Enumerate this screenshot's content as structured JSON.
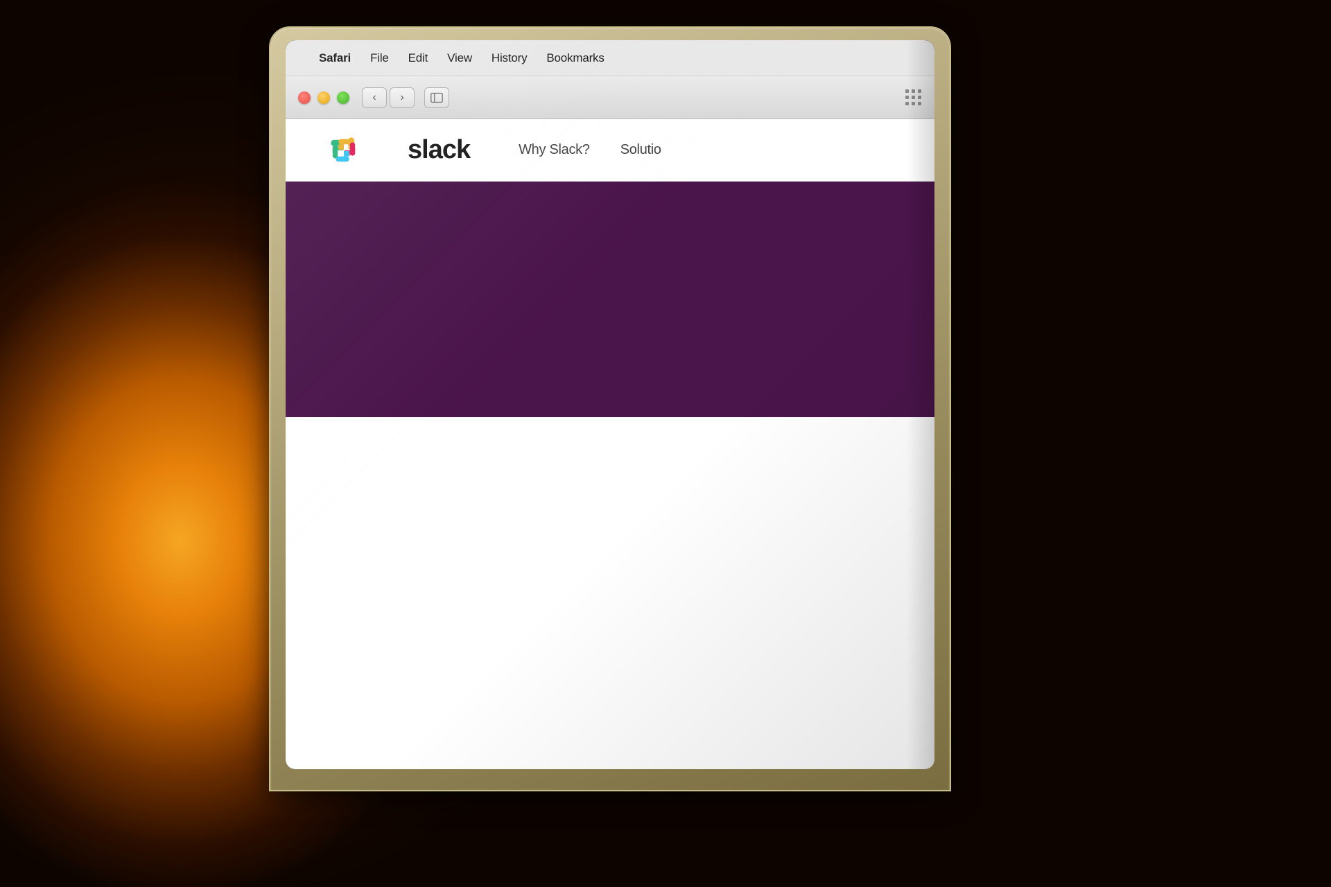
{
  "background": {
    "description": "Warm bokeh background with glowing Edison bulb"
  },
  "laptop": {
    "frame_color": "#b8ab80"
  },
  "menubar": {
    "apple_symbol": "",
    "items": [
      {
        "label": "Safari",
        "bold": true
      },
      {
        "label": "File",
        "bold": false
      },
      {
        "label": "Edit",
        "bold": false
      },
      {
        "label": "View",
        "bold": false
      },
      {
        "label": "History",
        "bold": false
      },
      {
        "label": "Bookmarks",
        "bold": false
      }
    ]
  },
  "safari": {
    "back_label": "‹",
    "forward_label": "›"
  },
  "slack": {
    "logo_text": "slack",
    "nav_items": [
      {
        "label": "Why Slack?"
      },
      {
        "label": "Solutio"
      }
    ],
    "hero_color": "#4a154b"
  }
}
